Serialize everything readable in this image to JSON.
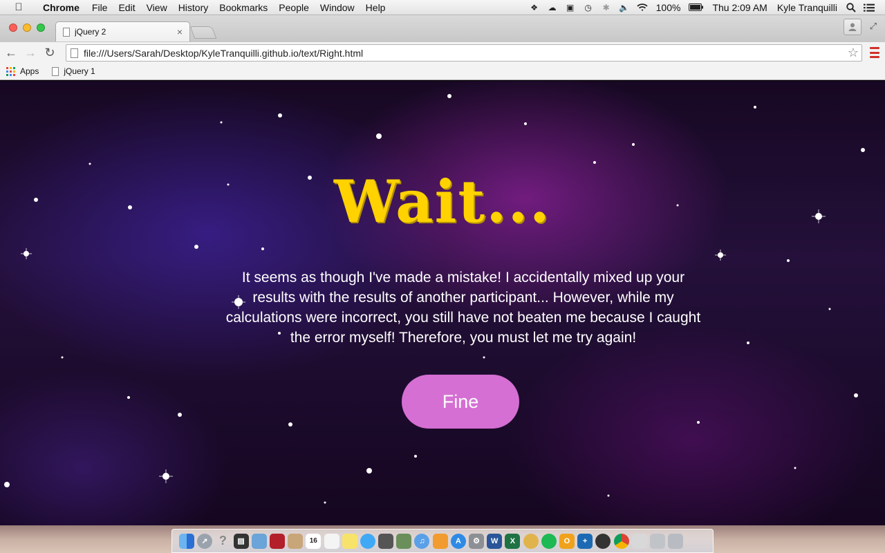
{
  "menubar": {
    "apple": "",
    "items": [
      "Chrome",
      "File",
      "Edit",
      "View",
      "History",
      "Bookmarks",
      "People",
      "Window",
      "Help"
    ],
    "status_icons": [
      "dropbox-icon",
      "creative-cloud-icon",
      "display-icon",
      "time-machine-icon",
      "bluetooth-icon",
      "volume-icon",
      "wifi-icon"
    ],
    "battery": "100%",
    "clock": "Thu 2:09 AM",
    "user": "Kyle Tranquilli"
  },
  "browser": {
    "tab_title": "jQuery 2",
    "tab_close": "×",
    "url": "file:///Users/Sarah/Desktop/KyleTranquilli.github.io/text/Right.html",
    "bookmarks": [
      "Apps",
      "jQuery 1"
    ]
  },
  "page": {
    "heading": "Wait...",
    "message": "It seems as though I've made a mistake! I accidentally mixed up your results with the results of another participant... However, while my calculations were incorrect, you still have not beaten me because I caught the error myself! Therefore, you must let me try again!",
    "button": "Fine"
  },
  "colors": {
    "heading": "#ffd200",
    "button": "#d56fd3"
  },
  "dock": {
    "icons": [
      "finder-icon",
      "launchpad-icon",
      "help-icon",
      "activity-monitor-icon",
      "preview-icon",
      "photo-booth-icon",
      "contacts-icon",
      "calendar-icon",
      "textedit-icon",
      "stickies-icon",
      "messages-icon",
      "facetime-icon",
      "photos-icon",
      "itunes-icon",
      "ibooks-icon",
      "app-store-icon",
      "system-preferences-icon",
      "word-icon",
      "excel-icon",
      "cyberduck-icon",
      "spotify-icon",
      "outlook-icon",
      "terminal-icon",
      "github-icon",
      "chrome-icon",
      "documents-icon",
      "downloads-icon",
      "trash-icon"
    ],
    "calendar_day": "16"
  }
}
